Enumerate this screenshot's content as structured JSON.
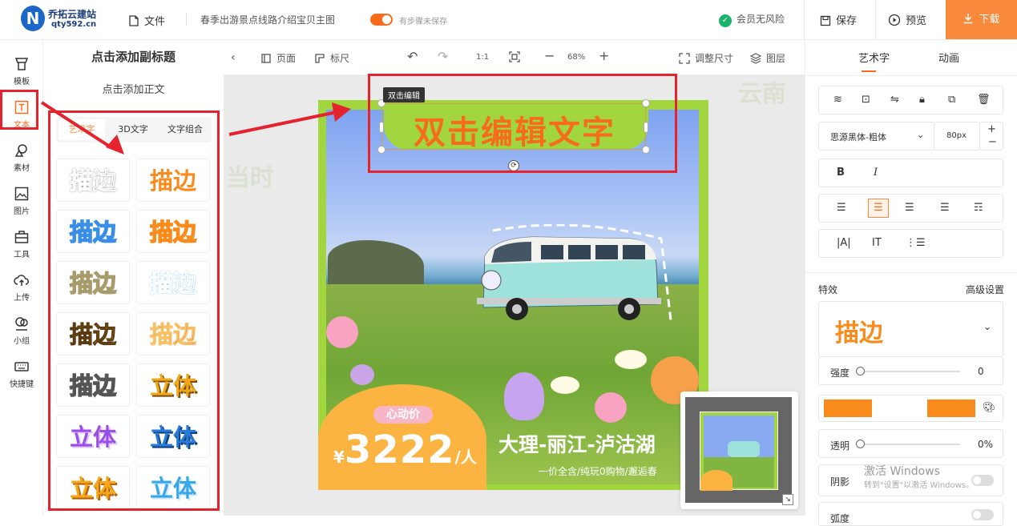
{
  "header": {
    "logo_letter": "N",
    "logo_title": "乔拓云建站",
    "logo_url": "qty592.cn",
    "file_label": "文件",
    "doc_title": "春季出游景点线路介绍宝贝主图",
    "unsaved_text": "有步骤未保存",
    "vip_text": "会员无风险",
    "save_label": "保存",
    "preview_label": "预览",
    "download_label": "下载"
  },
  "rail": {
    "items": [
      {
        "label": "模板",
        "icon": "template-icon"
      },
      {
        "label": "文本",
        "icon": "text-icon"
      },
      {
        "label": "素材",
        "icon": "material-icon"
      },
      {
        "label": "图片",
        "icon": "image-icon"
      },
      {
        "label": "工具",
        "icon": "tools-icon"
      },
      {
        "label": "上传",
        "icon": "upload-icon"
      },
      {
        "label": "小组",
        "icon": "group-icon"
      },
      {
        "label": "快捷键",
        "icon": "keyboard-icon"
      }
    ]
  },
  "text_panel": {
    "add_subtitle": "点击添加副标题",
    "add_body": "点击添加正文",
    "tabs": [
      "艺术字",
      "3D文字",
      "文字组合"
    ],
    "styles": [
      {
        "text": "描边",
        "color": "#222222"
      },
      {
        "text": "描边",
        "color": "#f98a1c"
      },
      {
        "text": "描边",
        "color": "#3a8ee6"
      },
      {
        "text": "描边",
        "color": "#f98a1c"
      },
      {
        "text": "描边",
        "color": "#a79a6b"
      },
      {
        "text": "描边",
        "color": "#2196d8"
      },
      {
        "text": "描边",
        "color": "#e9a21a"
      },
      {
        "text": "描边",
        "color": "#d9362b"
      },
      {
        "text": "描边",
        "color": "#555555"
      },
      {
        "text": "立体",
        "color": "#f0a81b"
      },
      {
        "text": "立体",
        "color": "#9b4ee6"
      },
      {
        "text": "立体",
        "color": "#2a7bd8"
      },
      {
        "text": "立体",
        "color": "#f5a61a"
      },
      {
        "text": "立体",
        "color": "#38a6e8"
      }
    ]
  },
  "canvas_toolbar": {
    "page_label": "页面",
    "ruler_label": "标尺",
    "ratio_label": "1:1",
    "zoom": "68%",
    "resize_label": "调整尺寸",
    "layers_label": "图层"
  },
  "poster": {
    "tooltip": "双击编辑",
    "title": "双击编辑文字",
    "price_tag": "心动价",
    "currency": "¥",
    "price": "3222",
    "unit": "/人",
    "route": "大理-丽江-泸沽湖",
    "route_sub": "一价全含/纯玩0购物/邂逅春",
    "ghost_left": "当时",
    "ghost_right": "云南"
  },
  "right_panel": {
    "tabs": [
      "艺术字",
      "动画"
    ],
    "font_name": "思源黑体-粗体",
    "font_size": "80px",
    "effects_label": "特效",
    "advanced_label": "高级设置",
    "effect_preview": "描边",
    "strength_label": "强度",
    "strength_value": "0",
    "opacity_label": "透明",
    "opacity_value": "0%",
    "shadow_label": "阴影",
    "arc_label": "弧度",
    "swatch_color": "#f98a1c"
  },
  "watermark": {
    "line1": "激活 Windows",
    "line2": "转到\"设置\"以激活 Windows。"
  }
}
